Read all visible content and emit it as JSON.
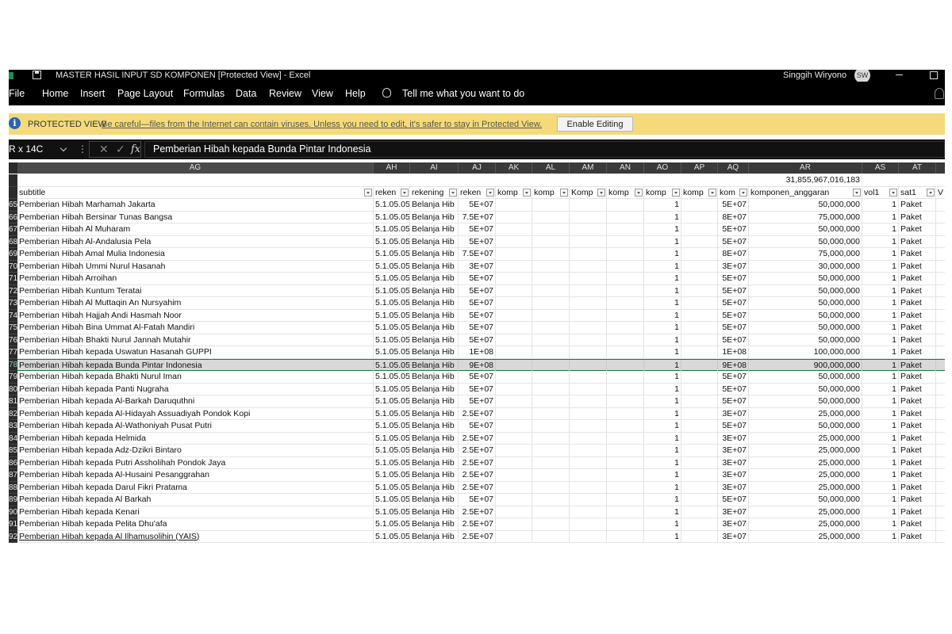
{
  "window": {
    "title": "MASTER HASIL INPUT SD KOMPONEN  [Protected View]  -  Excel",
    "user_name": "Singgih Wiryono",
    "user_initials": "SW"
  },
  "menu": {
    "items": [
      "File",
      "Home",
      "Insert",
      "Page Layout",
      "Formulas",
      "Data",
      "Review",
      "View",
      "Help"
    ],
    "tell_me": "Tell me what you want to do"
  },
  "protected_view": {
    "label": "PROTECTED VIEW",
    "message": "Be careful—files from the Internet can contain viruses. Unless you need to edit, it's safer to stay in Protected View.",
    "button": "Enable Editing"
  },
  "formula_bar": {
    "name_box": "R x 14C",
    "fx": "fx",
    "content": "Pemberian Hibah kepada Bunda Pintar Indonesia"
  },
  "columns": [
    "AG",
    "AH",
    "AI",
    "AJ",
    "AK",
    "AL",
    "AM",
    "AN",
    "AO",
    "AP",
    "AQ",
    "AR",
    "AS",
    "AT"
  ],
  "total": "31,855,967,016,183",
  "headers": [
    "subtitle",
    "reken",
    "rekening",
    "reken",
    "komp",
    "komp",
    "Komp",
    "komp",
    "komp",
    "komp",
    "kom",
    "komponen_anggaran",
    "vol1",
    "sat1",
    "V"
  ],
  "selected_row": "78",
  "rows": [
    {
      "n": "65",
      "subtitle": "Pemberian Hibah Marhamah Jakarta",
      "rek1": "5.1.05.05.",
      "rek2": "Belanja Hib",
      "rek3": "5E+07",
      "ao": "1",
      "aq": "5E+07",
      "ar": "50,000,000",
      "vol": "1",
      "sat": "Paket"
    },
    {
      "n": "66",
      "subtitle": "Pemberian Hibah Bersinar Tunas Bangsa",
      "rek1": "5.1.05.05.",
      "rek2": "Belanja Hib",
      "rek3": "7.5E+07",
      "ao": "1",
      "aq": "8E+07",
      "ar": "75,000,000",
      "vol": "1",
      "sat": "Paket"
    },
    {
      "n": "67",
      "subtitle": "Pemberian Hibah Al Muharam",
      "rek1": "5.1.05.05.",
      "rek2": "Belanja Hib",
      "rek3": "5E+07",
      "ao": "1",
      "aq": "5E+07",
      "ar": "50,000,000",
      "vol": "1",
      "sat": "Paket"
    },
    {
      "n": "68",
      "subtitle": "Pemberian Hibah Al-Andalusia Pela",
      "rek1": "5.1.05.05.",
      "rek2": "Belanja Hib",
      "rek3": "5E+07",
      "ao": "1",
      "aq": "5E+07",
      "ar": "50,000,000",
      "vol": "1",
      "sat": "Paket"
    },
    {
      "n": "69",
      "subtitle": "Pemberian Hibah Amal Mulia Indonesia",
      "rek1": "5.1.05.05.",
      "rek2": "Belanja Hib",
      "rek3": "7.5E+07",
      "ao": "1",
      "aq": "8E+07",
      "ar": "75,000,000",
      "vol": "1",
      "sat": "Paket"
    },
    {
      "n": "70",
      "subtitle": "Pemberian Hibah Ummi Nurul Hasanah",
      "rek1": "5.1.05.05.",
      "rek2": "Belanja Hib",
      "rek3": "3E+07",
      "ao": "1",
      "aq": "3E+07",
      "ar": "30,000,000",
      "vol": "1",
      "sat": "Paket"
    },
    {
      "n": "71",
      "subtitle": "Pemberian Hibah Arroihan",
      "rek1": "5.1.05.05.",
      "rek2": "Belanja Hib",
      "rek3": "5E+07",
      "ao": "1",
      "aq": "5E+07",
      "ar": "50,000,000",
      "vol": "1",
      "sat": "Paket"
    },
    {
      "n": "72",
      "subtitle": "Pemberian Hibah Kuntum Teratai",
      "rek1": "5.1.05.05.",
      "rek2": "Belanja Hib",
      "rek3": "5E+07",
      "ao": "1",
      "aq": "5E+07",
      "ar": "50,000,000",
      "vol": "1",
      "sat": "Paket"
    },
    {
      "n": "73",
      "subtitle": "Pemberian Hibah Al Muttaqin An Nursyahim",
      "rek1": "5.1.05.05.",
      "rek2": "Belanja Hib",
      "rek3": "5E+07",
      "ao": "1",
      "aq": "5E+07",
      "ar": "50,000,000",
      "vol": "1",
      "sat": "Paket"
    },
    {
      "n": "74",
      "subtitle": "Pemberian Hibah Hajjah Andi Hasmah Noor",
      "rek1": "5.1.05.05.",
      "rek2": "Belanja Hib",
      "rek3": "5E+07",
      "ao": "1",
      "aq": "5E+07",
      "ar": "50,000,000",
      "vol": "1",
      "sat": "Paket"
    },
    {
      "n": "75",
      "subtitle": "Pemberian Hibah Bina Ummat Al-Fatah Mandiri",
      "rek1": "5.1.05.05.",
      "rek2": "Belanja Hib",
      "rek3": "5E+07",
      "ao": "1",
      "aq": "5E+07",
      "ar": "50,000,000",
      "vol": "1",
      "sat": "Paket"
    },
    {
      "n": "76",
      "subtitle": "Pemberian Hibah Bhakti Nurul Jannah Mutahir",
      "rek1": "5.1.05.05.",
      "rek2": "Belanja Hib",
      "rek3": "5E+07",
      "ao": "1",
      "aq": "5E+07",
      "ar": "50,000,000",
      "vol": "1",
      "sat": "Paket"
    },
    {
      "n": "77",
      "subtitle": "Pemberian Hibah kepada Uswatun Hasanah GUPPI",
      "rek1": "5.1.05.05.",
      "rek2": "Belanja Hib",
      "rek3": "1E+08",
      "ao": "1",
      "aq": "1E+08",
      "ar": "100,000,000",
      "vol": "1",
      "sat": "Paket"
    },
    {
      "n": "78",
      "subtitle": "Pemberian Hibah kepada Bunda Pintar Indonesia",
      "rek1": "5.1.05.05.",
      "rek2": "Belanja Hib",
      "rek3": "9E+08",
      "ao": "1",
      "aq": "9E+08",
      "ar": "900,000,000",
      "vol": "1",
      "sat": "Paket"
    },
    {
      "n": "79",
      "subtitle": "Pemberian Hibah kepada Bhakti Nurul Iman",
      "rek1": "5.1.05.05.",
      "rek2": "Belanja Hib",
      "rek3": "5E+07",
      "ao": "1",
      "aq": "5E+07",
      "ar": "50,000,000",
      "vol": "1",
      "sat": "Paket"
    },
    {
      "n": "80",
      "subtitle": "Pemberian Hibah kepada Panti Nugraha",
      "rek1": "5.1.05.05.",
      "rek2": "Belanja Hib",
      "rek3": "5E+07",
      "ao": "1",
      "aq": "5E+07",
      "ar": "50,000,000",
      "vol": "1",
      "sat": "Paket"
    },
    {
      "n": "81",
      "subtitle": "Pemberian Hibah kepada Al-Barkah Daruquthni",
      "rek1": "5.1.05.05.",
      "rek2": "Belanja Hib",
      "rek3": "5E+07",
      "ao": "1",
      "aq": "5E+07",
      "ar": "50,000,000",
      "vol": "1",
      "sat": "Paket"
    },
    {
      "n": "82",
      "subtitle": "Pemberian Hibah kepada Al-Hidayah Assuadiyah Pondok Kopi",
      "rek1": "5.1.05.05.",
      "rek2": "Belanja Hib",
      "rek3": "2.5E+07",
      "ao": "1",
      "aq": "3E+07",
      "ar": "25,000,000",
      "vol": "1",
      "sat": "Paket"
    },
    {
      "n": "83",
      "subtitle": "Pemberian Hibah kepada Al-Wathoniyah Pusat Putri",
      "rek1": "5.1.05.05.",
      "rek2": "Belanja Hib",
      "rek3": "5E+07",
      "ao": "1",
      "aq": "5E+07",
      "ar": "50,000,000",
      "vol": "1",
      "sat": "Paket"
    },
    {
      "n": "84",
      "subtitle": "Pemberian Hibah kepada Helmida",
      "rek1": "5.1.05.05.",
      "rek2": "Belanja Hib",
      "rek3": "2.5E+07",
      "ao": "1",
      "aq": "3E+07",
      "ar": "25,000,000",
      "vol": "1",
      "sat": "Paket"
    },
    {
      "n": "85",
      "subtitle": "Pemberian Hibah kepada Adz-Dzikri Bintaro",
      "rek1": "5.1.05.05.",
      "rek2": "Belanja Hib",
      "rek3": "2.5E+07",
      "ao": "1",
      "aq": "3E+07",
      "ar": "25,000,000",
      "vol": "1",
      "sat": "Paket"
    },
    {
      "n": "86",
      "subtitle": "Pemberian Hibah kepada Putri Assholihah Pondok Jaya",
      "rek1": "5.1.05.05.",
      "rek2": "Belanja Hib",
      "rek3": "2.5E+07",
      "ao": "1",
      "aq": "3E+07",
      "ar": "25,000,000",
      "vol": "1",
      "sat": "Paket"
    },
    {
      "n": "87",
      "subtitle": "Pemberian Hibah kepada Al-Husaini Pesanggrahan",
      "rek1": "5.1.05.05.",
      "rek2": "Belanja Hib",
      "rek3": "2.5E+07",
      "ao": "1",
      "aq": "3E+07",
      "ar": "25,000,000",
      "vol": "1",
      "sat": "Paket"
    },
    {
      "n": "88",
      "subtitle": "Pemberian Hibah kepada Darul Fikri Pratama",
      "rek1": "5.1.05.05.",
      "rek2": "Belanja Hib",
      "rek3": "2.5E+07",
      "ao": "1",
      "aq": "3E+07",
      "ar": "25,000,000",
      "vol": "1",
      "sat": "Paket"
    },
    {
      "n": "89",
      "subtitle": "Pemberian Hibah kepada Al Barkah",
      "rek1": "5.1.05.05.",
      "rek2": "Belanja Hib",
      "rek3": "5E+07",
      "ao": "1",
      "aq": "5E+07",
      "ar": "50,000,000",
      "vol": "1",
      "sat": "Paket"
    },
    {
      "n": "90",
      "subtitle": "Pemberian Hibah kepada Kenari",
      "rek1": "5.1.05.05.",
      "rek2": "Belanja Hib",
      "rek3": "2.5E+07",
      "ao": "1",
      "aq": "3E+07",
      "ar": "25,000,000",
      "vol": "1",
      "sat": "Paket"
    },
    {
      "n": "91",
      "subtitle": "Pemberian Hibah kepada Pelita Dhu'afa",
      "rek1": "5.1.05.05.",
      "rek2": "Belanja Hib",
      "rek3": "2.5E+07",
      "ao": "1",
      "aq": "3E+07",
      "ar": "25,000,000",
      "vol": "1",
      "sat": "Paket"
    },
    {
      "n": "92",
      "subtitle": "Pemberian Hibah kepada Al Ilhamusolihin (YAIS)",
      "rek1": "5.1.05.05.",
      "rek2": "Belanja Hib",
      "rek3": "2.5E+07",
      "ao": "1",
      "aq": "3E+07",
      "ar": "25,000,000",
      "vol": "1",
      "sat": "Paket"
    }
  ]
}
